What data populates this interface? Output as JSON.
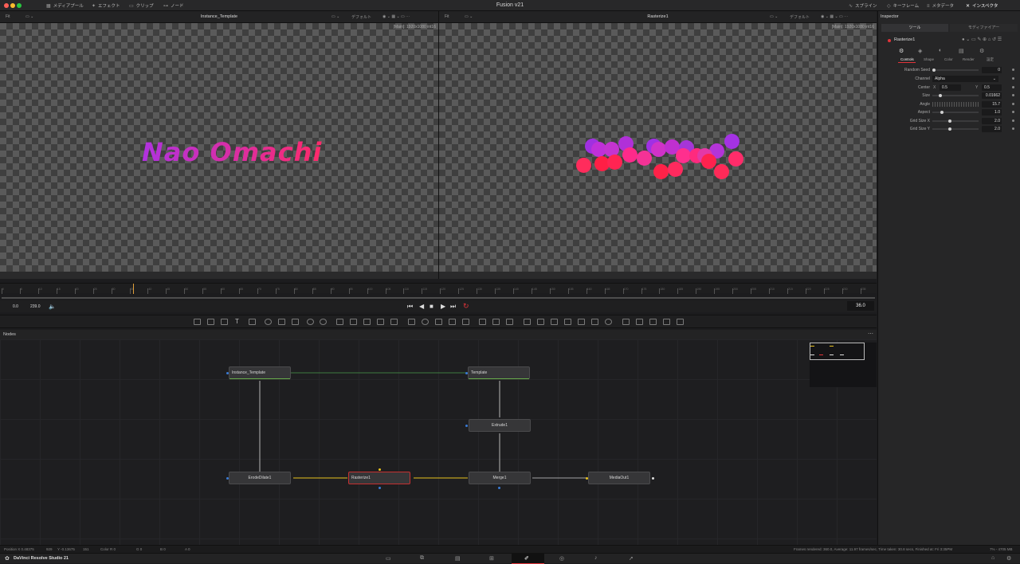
{
  "app": {
    "title": "Fusion v21",
    "footer_name": "DaVinci Resolve Studio 21"
  },
  "topbar": {
    "left_buttons": [
      {
        "label": "メディアプール",
        "icon": "media-pool-icon"
      },
      {
        "label": "エフェクト",
        "icon": "effects-icon"
      },
      {
        "label": "クリップ",
        "icon": "clips-icon"
      },
      {
        "label": "ノード",
        "icon": "nodes-icon"
      }
    ],
    "right_buttons": [
      {
        "label": "スプライン",
        "icon": "spline-icon"
      },
      {
        "label": "キーフレーム",
        "icon": "keyframes-icon"
      },
      {
        "label": "メタデータ",
        "icon": "metadata-icon"
      },
      {
        "label": "インスペクタ",
        "icon": "inspector-icon"
      }
    ]
  },
  "viewers": {
    "left": {
      "fit": "Fit",
      "title": "Instance_Template",
      "mode": "デフォルト",
      "info": "[Main]: 1920x1080 int16",
      "text": "Nao Omachi"
    },
    "right": {
      "fit": "Fit",
      "title": "Rasterize1",
      "mode": "デフォルト",
      "info": "[Main]: 1920x1080 int16"
    }
  },
  "timeline": {
    "ticks": [
      "0",
      "5",
      "10",
      "15",
      "20",
      "25",
      "30",
      "35",
      "40",
      "45",
      "50",
      "55",
      "60",
      "65",
      "70",
      "75",
      "80",
      "85",
      "90",
      "95",
      "100",
      "105",
      "110",
      "115",
      "120",
      "125",
      "130",
      "135",
      "140",
      "145",
      "150",
      "155",
      "160",
      "165",
      "170",
      "175",
      "180",
      "185",
      "190",
      "195",
      "200",
      "205",
      "210",
      "215",
      "220",
      "225",
      "230",
      "235"
    ],
    "start": "0.0",
    "end": "239.0",
    "current": "36.0",
    "playhead_frame": 36,
    "total_frames": 239
  },
  "nodes_panel": {
    "title": "Nodes",
    "nodes": [
      {
        "id": "instance_template",
        "label": "Instance_Template"
      },
      {
        "id": "template",
        "label": "Template"
      },
      {
        "id": "extrude",
        "label": "Extrude1"
      },
      {
        "id": "erode",
        "label": "ErodeDilate1"
      },
      {
        "id": "rasterize",
        "label": "Rasterize1"
      },
      {
        "id": "merge",
        "label": "Merge1"
      },
      {
        "id": "mediaout",
        "label": "MediaOut1"
      }
    ]
  },
  "inspector": {
    "title": "Inspector",
    "tabs": [
      "ツール",
      "モディファイアー"
    ],
    "tool_name": "Rasterize1",
    "subtabs": [
      "Controls",
      "Shape",
      "Color",
      "Render",
      "設定"
    ],
    "params": [
      {
        "label": "Random Seed",
        "value": "0"
      },
      {
        "label": "Channel",
        "value": "Alpha"
      },
      {
        "label": "Center",
        "x_label": "X",
        "x": "0.5",
        "y_label": "Y",
        "y": "0.5"
      },
      {
        "label": "Size",
        "value": "0.01662"
      },
      {
        "label": "Angle",
        "value": "15.7"
      },
      {
        "label": "Aspect",
        "value": "1.0"
      },
      {
        "label": "Grid Size X",
        "value": "2.0"
      },
      {
        "label": "Grid Size Y",
        "value": "2.0"
      }
    ]
  },
  "status": {
    "position_x": "Position  X 0.48375",
    "x_val": "929",
    "position_y": "Y -0.13675",
    "y_val": "151",
    "color": "Color  R 0",
    "g": "G 0",
    "b": "B 0",
    "a": "A 0",
    "right": "Frames rendered: 360.0, Average: 11.97 frames/sec, Time taken: 30.8 secs, Finished at: Fri 3:35PM",
    "memory": "7% - 4705 MB"
  },
  "colors": {
    "accent": "#e2343a",
    "text_gradient_start": "#b032e0",
    "text_gradient_end": "#ff2a6a"
  }
}
